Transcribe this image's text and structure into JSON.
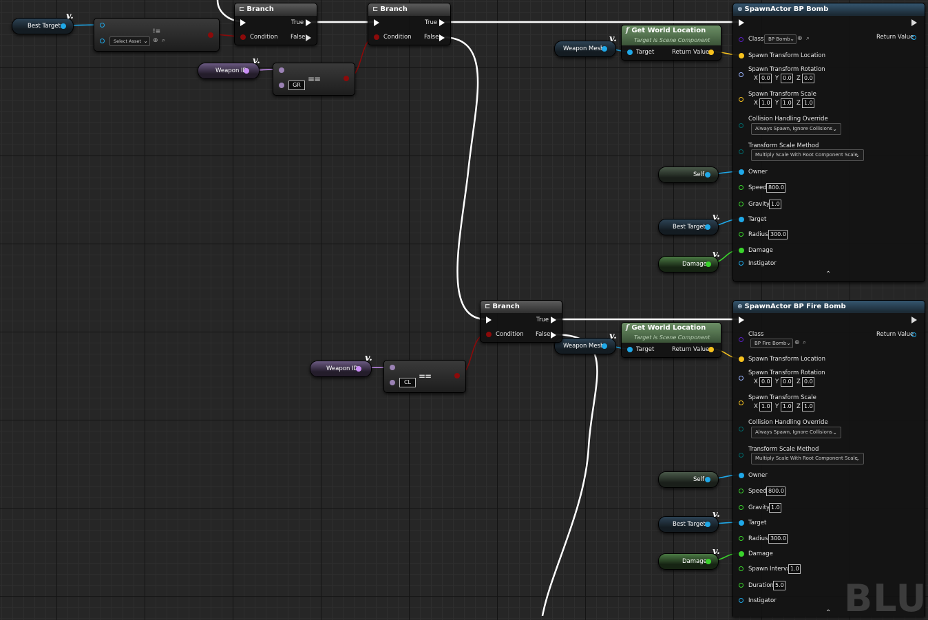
{
  "variables": {
    "best_target": "Best Target",
    "weapon_id": "Weapon ID",
    "weapon_mesh": "Weapon Mesh",
    "self": "Self",
    "damage": "Damage"
  },
  "select_node": {
    "placeholder": "Select Asset"
  },
  "compare_top": {
    "value": "GR",
    "op": "=="
  },
  "compare_bottom": {
    "value": "CL",
    "op": "=="
  },
  "branch": {
    "title": "Branch",
    "true_label": "True",
    "false_label": "False",
    "condition_label": "Condition"
  },
  "get_world_location": {
    "title": "Get World Location",
    "subtitle": "Target is Scene Component",
    "target_label": "Target",
    "return_label": "Return Value"
  },
  "spawn_bomb": {
    "title": "SpawnActor BP Bomb",
    "class_label": "Class",
    "class_value": "BP Bomb",
    "return_label": "Return Value",
    "loc_label": "Spawn Transform Location",
    "rot_label": "Spawn Transform Rotation",
    "rot": [
      "0.0",
      "0.0",
      "0.0"
    ],
    "scale_label": "Spawn Transform Scale",
    "scale": [
      "1.0",
      "1.0",
      "1.0"
    ],
    "collision_label": "Collision Handling Override",
    "collision_value": "Always Spawn, Ignore Collisions",
    "method_label": "Transform Scale Method",
    "method_value": "Multiply Scale With Root Component Scale",
    "owner_label": "Owner",
    "speed_label": "Speed",
    "speed": "800.0",
    "gravity_label": "Gravity",
    "gravity": "1.0",
    "target_label": "Target",
    "radius_label": "Radius",
    "radius": "300.0",
    "damage_label": "Damage",
    "instigator_label": "Instigator"
  },
  "spawn_fire": {
    "title": "SpawnActor BP Fire Bomb",
    "class_label": "Class",
    "class_value": "BP Fire Bomb",
    "return_label": "Return Value",
    "loc_label": "Spawn Transform Location",
    "rot_label": "Spawn Transform Rotation",
    "rot": [
      "0.0",
      "0.0",
      "0.0"
    ],
    "scale_label": "Spawn Transform Scale",
    "scale": [
      "1.0",
      "1.0",
      "1.0"
    ],
    "collision_label": "Collision Handling Override",
    "collision_value": "Always Spawn, Ignore Collisions",
    "method_label": "Transform Scale Method",
    "method_value": "Multiply Scale With Root Component Scale",
    "owner_label": "Owner",
    "speed_label": "Speed",
    "speed": "800.0",
    "gravity_label": "Gravity",
    "gravity": "1.0",
    "target_label": "Target",
    "radius_label": "Radius",
    "radius": "300.0",
    "damage_label": "Damage",
    "interval_label": "Spawn Interval",
    "interval": "1.0",
    "duration_label": "Duration",
    "duration": "5.0",
    "instigator_label": "Instigator"
  },
  "axis": {
    "x": "X",
    "y": "Y",
    "z": "Z"
  },
  "watermark": "BLUE",
  "colors": {
    "exec": "#ffffff",
    "object": "#1fa8e8",
    "bool": "#8c0a0a",
    "name": "#c98ef5",
    "float": "#3ad32c",
    "vector": "#f7c21e",
    "rotator": "#9bb5ff",
    "class": "#5a1fc4",
    "struct": "#00686a"
  }
}
